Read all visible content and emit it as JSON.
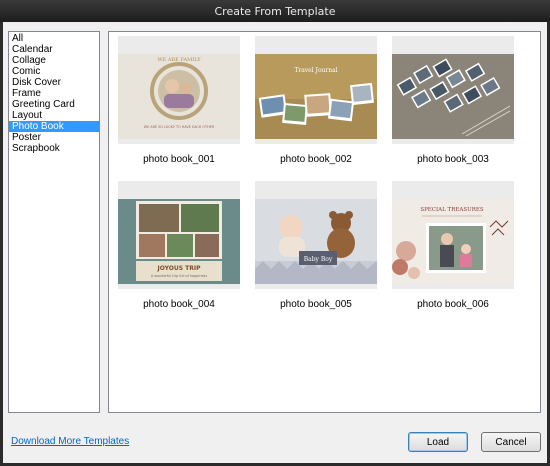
{
  "window": {
    "title": "Create From Template"
  },
  "categories": [
    {
      "label": "All"
    },
    {
      "label": "Calendar"
    },
    {
      "label": "Collage"
    },
    {
      "label": "Comic"
    },
    {
      "label": "Disk Cover"
    },
    {
      "label": "Frame"
    },
    {
      "label": "Greeting Card"
    },
    {
      "label": "Layout"
    },
    {
      "label": "Photo Book",
      "selected": true
    },
    {
      "label": "Poster"
    },
    {
      "label": "Scrapbook"
    }
  ],
  "templates": [
    {
      "name": "photo book_001",
      "art_text": [
        "WE ARE FAMILY",
        "WE ARE SO LUCKY TO HAVE EACH OTHER"
      ]
    },
    {
      "name": "photo book_002",
      "art_text": [
        "Travel Journal"
      ]
    },
    {
      "name": "photo book_003",
      "art_text": []
    },
    {
      "name": "photo book_004",
      "art_text": [
        "JOYOUS TRIP",
        "A wonderful trip full of happiness"
      ]
    },
    {
      "name": "photo book_005",
      "art_text": [
        "Baby Boy"
      ]
    },
    {
      "name": "photo book_006",
      "art_text": [
        "SPECIAL TREASURES"
      ]
    }
  ],
  "footer": {
    "download_link": "Download More Templates",
    "load_label": "Load",
    "cancel_label": "Cancel"
  },
  "colors": {
    "selection": "#3399ff",
    "link": "#0066cc",
    "titlebar": "#2a2a2a"
  }
}
